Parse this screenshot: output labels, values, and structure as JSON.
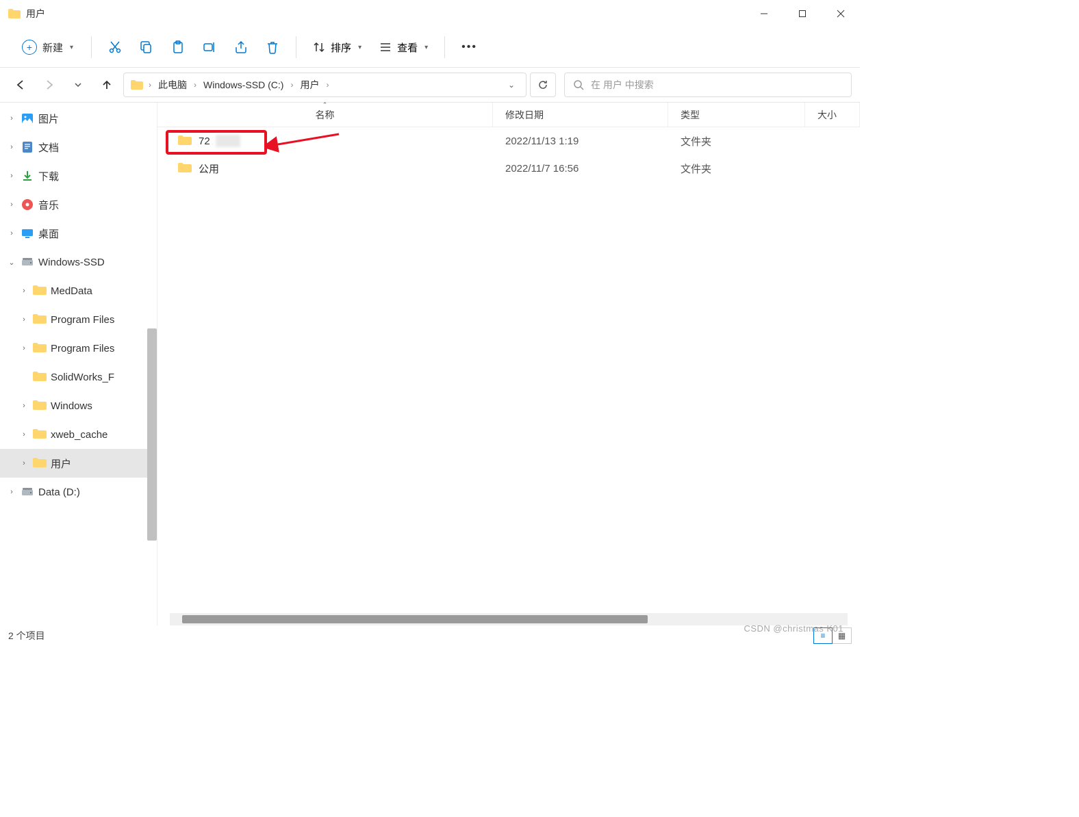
{
  "window": {
    "title": "用户"
  },
  "toolbar": {
    "new_label": "新建",
    "sort_label": "排序",
    "view_label": "查看"
  },
  "breadcrumb": {
    "items": [
      "此电脑",
      "Windows-SSD (C:)",
      "用户"
    ]
  },
  "search": {
    "placeholder": "在 用户 中搜索"
  },
  "sidebar": {
    "items": [
      {
        "label": "图片",
        "icon": "pictures",
        "indent": 0,
        "chev": "right"
      },
      {
        "label": "文档",
        "icon": "documents",
        "indent": 0,
        "chev": "right"
      },
      {
        "label": "下载",
        "icon": "downloads",
        "indent": 0,
        "chev": "right"
      },
      {
        "label": "音乐",
        "icon": "music",
        "indent": 0,
        "chev": "right"
      },
      {
        "label": "桌面",
        "icon": "desktop",
        "indent": 0,
        "chev": "right"
      },
      {
        "label": "Windows-SSD",
        "icon": "drive",
        "indent": 0,
        "chev": "down"
      },
      {
        "label": "MedData",
        "icon": "folder",
        "indent": 1,
        "chev": "right"
      },
      {
        "label": "Program Files",
        "icon": "folder",
        "indent": 1,
        "chev": "right"
      },
      {
        "label": "Program Files",
        "icon": "folder",
        "indent": 1,
        "chev": "right"
      },
      {
        "label": "SolidWorks_F",
        "icon": "folder",
        "indent": 1,
        "chev": "none"
      },
      {
        "label": "Windows",
        "icon": "folder",
        "indent": 1,
        "chev": "right"
      },
      {
        "label": "xweb_cache",
        "icon": "folder",
        "indent": 1,
        "chev": "right"
      },
      {
        "label": "用户",
        "icon": "folder",
        "indent": 1,
        "chev": "right",
        "selected": true
      },
      {
        "label": "Data (D:)",
        "icon": "drive",
        "indent": 0,
        "chev": "right"
      }
    ]
  },
  "columns": {
    "name": "名称",
    "date": "修改日期",
    "type": "类型",
    "size": "大小"
  },
  "files": [
    {
      "name": "72",
      "date": "2022/11/13 1:19",
      "type": "文件夹",
      "highlighted": true
    },
    {
      "name": "公用",
      "date": "2022/11/7 16:56",
      "type": "文件夹"
    }
  ],
  "status": {
    "item_count": "2 个项目"
  },
  "watermark": "CSDN @christmas K01"
}
